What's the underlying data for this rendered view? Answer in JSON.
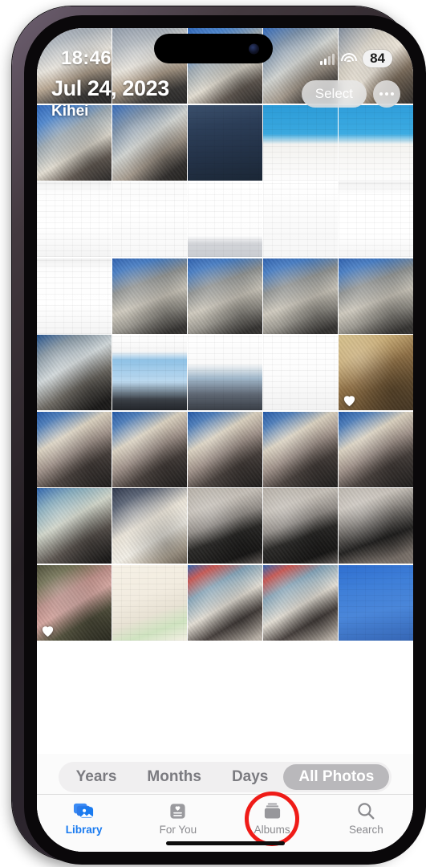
{
  "device": {
    "frame": "iphone-14-pro",
    "bezel_color": "#0a080a"
  },
  "status_bar": {
    "time": "18:46",
    "cellular_icon": "cellular-signal-icon",
    "wifi_icon": "wifi-icon",
    "battery_level": "84"
  },
  "nav": {
    "date": "Jul 24, 2023",
    "place": "Kihei",
    "select_label": "Select",
    "more_icon": "ellipsis-icon"
  },
  "segmented_control": {
    "options": [
      "Years",
      "Months",
      "Days",
      "All Photos"
    ],
    "selected": "All Photos",
    "selected_index": 3
  },
  "tab_bar": {
    "tabs": [
      {
        "label": "Library",
        "icon": "photo-library-icon",
        "selected": true,
        "annotated": false
      },
      {
        "label": "For You",
        "icon": "for-you-heart-card-icon",
        "selected": false,
        "annotated": false
      },
      {
        "label": "Albums",
        "icon": "albums-stack-icon",
        "selected": false,
        "annotated": true
      },
      {
        "label": "Search",
        "icon": "magnifier-icon",
        "selected": false,
        "annotated": false
      }
    ],
    "active_color": "#1a7bf0",
    "inactive_color": "#8a8a8e",
    "annotation_color": "#ef1b17"
  },
  "grid": {
    "columns": 5,
    "rows": 9,
    "cells": [
      {
        "kind": "photo-dog-sleeping-blanket",
        "favorite": false
      },
      {
        "kind": "photo-dog-sleeping-blanket",
        "favorite": false
      },
      {
        "kind": "photo-dog-blue-couch",
        "favorite": false
      },
      {
        "kind": "photo-dog-blue-couch-blanket",
        "favorite": false
      },
      {
        "kind": "photo-dog-closeup",
        "favorite": false
      },
      {
        "kind": "photo-dog-blue-couch",
        "favorite": false
      },
      {
        "kind": "photo-dog-blue-couch-blanket",
        "favorite": false
      },
      {
        "kind": "screenshot-find-my-search",
        "favorite": false
      },
      {
        "kind": "screenshot-map-people",
        "favorite": false
      },
      {
        "kind": "screenshot-map-items",
        "favorite": false
      },
      {
        "kind": "screenshot-airtag-share",
        "favorite": false
      },
      {
        "kind": "screenshot-airtag-detail",
        "favorite": false
      },
      {
        "kind": "screenshot-keyboard-contacts",
        "favorite": false
      },
      {
        "kind": "screenshot-contacts-list",
        "favorite": false
      },
      {
        "kind": "screenshot-airtag-pending",
        "favorite": false
      },
      {
        "kind": "screenshot-airtag-share",
        "favorite": false
      },
      {
        "kind": "photo-dog-bed-couch",
        "favorite": false
      },
      {
        "kind": "photo-dog-bed-couch",
        "favorite": false
      },
      {
        "kind": "photo-dog-bed-couch",
        "favorite": false
      },
      {
        "kind": "photo-dog-bed-couch",
        "favorite": false
      },
      {
        "kind": "photo-cat-on-quilt",
        "favorite": false
      },
      {
        "kind": "screenshot-social-post-beach",
        "favorite": false
      },
      {
        "kind": "screenshot-social-post-text",
        "favorite": false
      },
      {
        "kind": "screenshot-channel-analytics",
        "favorite": false
      },
      {
        "kind": "photo-cat-on-cardboard",
        "favorite": true
      },
      {
        "kind": "photo-black-cat-shelf",
        "favorite": false
      },
      {
        "kind": "photo-black-cat-shelf",
        "favorite": false
      },
      {
        "kind": "photo-black-cat-shelf",
        "favorite": false
      },
      {
        "kind": "photo-black-cat-shelf",
        "favorite": false
      },
      {
        "kind": "photo-black-cat-shelf",
        "favorite": false
      },
      {
        "kind": "photo-black-cat-sitting",
        "favorite": false
      },
      {
        "kind": "photo-hand-holding-tissue",
        "favorite": false
      },
      {
        "kind": "photo-cat-by-door",
        "favorite": false
      },
      {
        "kind": "photo-cat-by-door",
        "favorite": false
      },
      {
        "kind": "photo-cat-by-door-feet",
        "favorite": false
      },
      {
        "kind": "photo-sushi-menu-board",
        "favorite": true
      },
      {
        "kind": "screenshot-street-map",
        "favorite": false
      },
      {
        "kind": "photo-dog-face-blanket",
        "favorite": false
      },
      {
        "kind": "photo-dog-face-blanket",
        "favorite": false
      },
      {
        "kind": "screenshot-home-screen-apps",
        "favorite": false
      }
    ]
  }
}
